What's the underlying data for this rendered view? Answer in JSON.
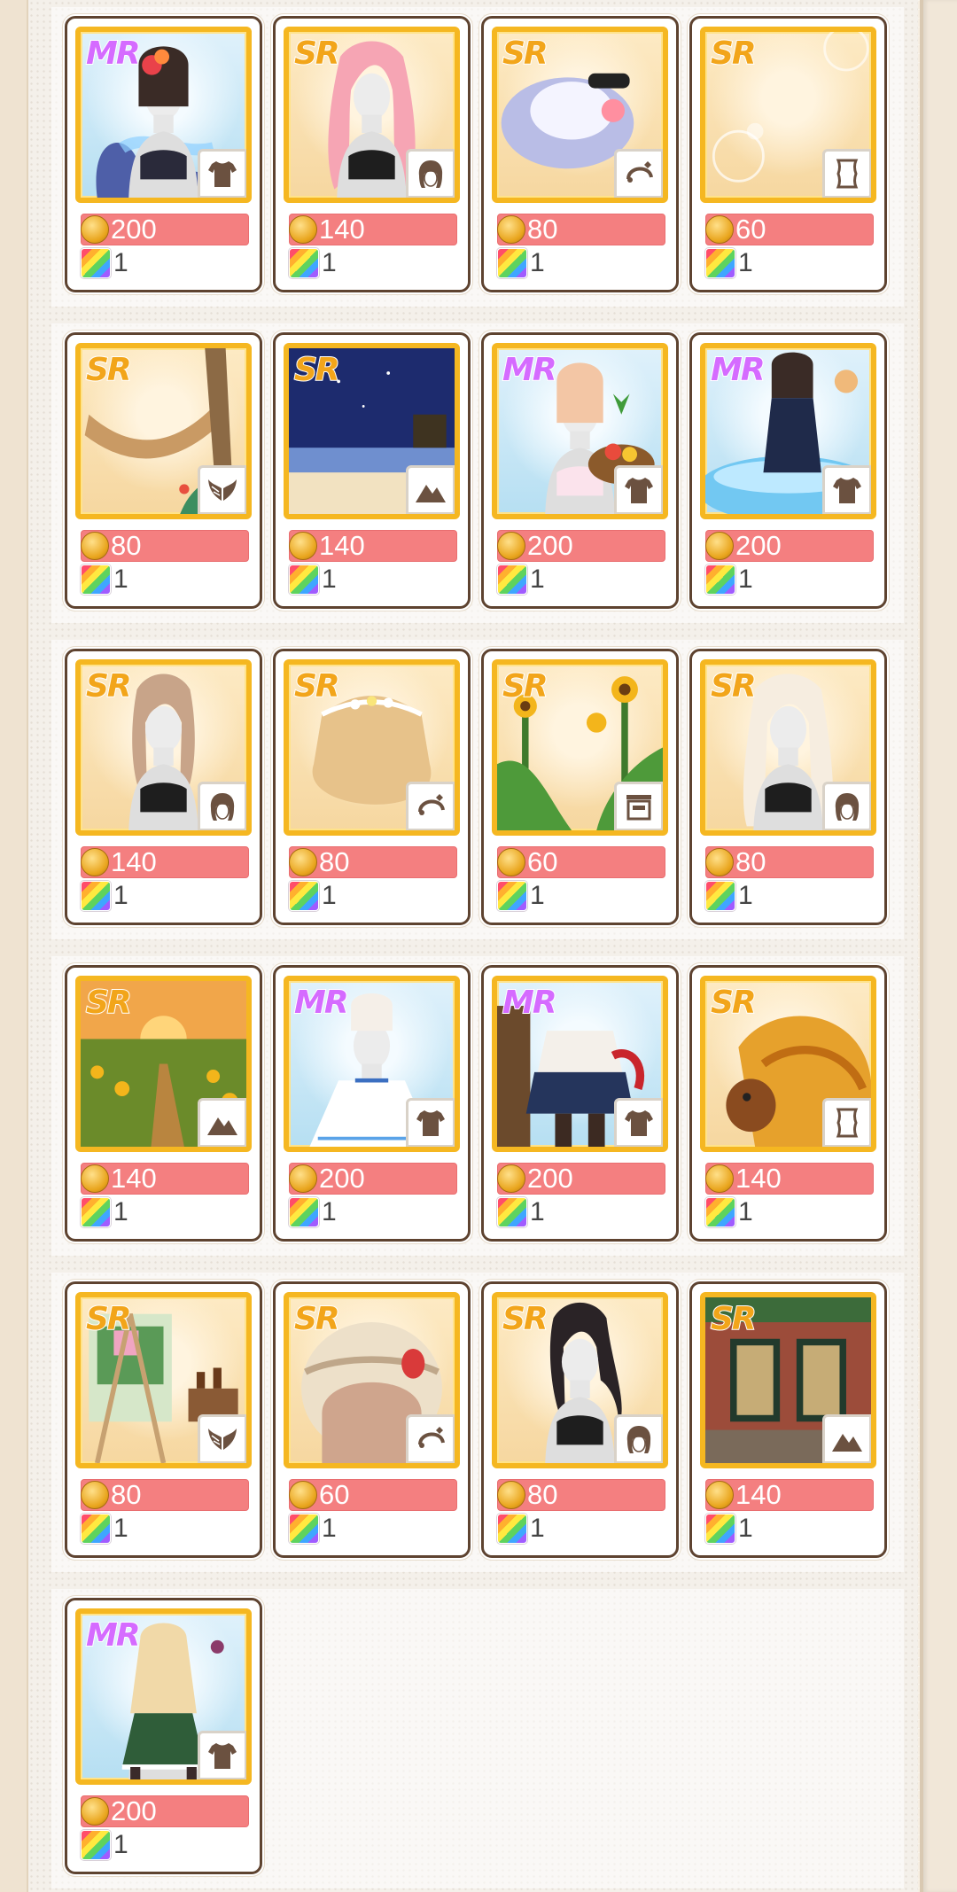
{
  "items": [
    {
      "rarity": "MR",
      "category": "clothes-icon",
      "price": "200",
      "qty": "1",
      "art": "swimsuit-mr"
    },
    {
      "rarity": "SR",
      "category": "hair-icon",
      "price": "140",
      "qty": "1",
      "art": "hair-pink"
    },
    {
      "rarity": "SR",
      "category": "accessory-icon",
      "price": "80",
      "qty": "1",
      "art": "sunhat"
    },
    {
      "rarity": "SR",
      "category": "frame-icon",
      "price": "60",
      "qty": "1",
      "art": "bubble-frame"
    },
    {
      "rarity": "SR",
      "category": "wings-icon",
      "price": "80",
      "qty": "1",
      "art": "hammock"
    },
    {
      "rarity": "SR",
      "category": "background-icon",
      "price": "140",
      "qty": "1",
      "art": "night-beach"
    },
    {
      "rarity": "MR",
      "category": "clothes-icon",
      "price": "200",
      "qty": "1",
      "art": "bikini-fruit"
    },
    {
      "rarity": "MR",
      "category": "clothes-icon",
      "price": "200",
      "qty": "1",
      "art": "pool-girl"
    },
    {
      "rarity": "SR",
      "category": "hair-icon",
      "price": "140",
      "qty": "1",
      "art": "hair-beige"
    },
    {
      "rarity": "SR",
      "category": "accessory-icon",
      "price": "80",
      "qty": "1",
      "art": "straw-hat"
    },
    {
      "rarity": "SR",
      "category": "furniture-icon",
      "price": "60",
      "qty": "1",
      "art": "sunflowers"
    },
    {
      "rarity": "SR",
      "category": "hair-icon",
      "price": "80",
      "qty": "1",
      "art": "hair-blonde"
    },
    {
      "rarity": "SR",
      "category": "background-icon",
      "price": "140",
      "qty": "1",
      "art": "sunflower-field"
    },
    {
      "rarity": "MR",
      "category": "clothes-icon",
      "price": "200",
      "qty": "1",
      "art": "white-dress"
    },
    {
      "rarity": "MR",
      "category": "clothes-icon",
      "price": "200",
      "qty": "1",
      "art": "sailor-outfit"
    },
    {
      "rarity": "SR",
      "category": "frame-icon",
      "price": "140",
      "qty": "1",
      "art": "autumn-leaves"
    },
    {
      "rarity": "SR",
      "category": "wings-icon",
      "price": "80",
      "qty": "1",
      "art": "easel"
    },
    {
      "rarity": "SR",
      "category": "accessory-icon",
      "price": "60",
      "qty": "1",
      "art": "knit-hat"
    },
    {
      "rarity": "SR",
      "category": "hair-icon",
      "price": "80",
      "qty": "1",
      "art": "hair-black"
    },
    {
      "rarity": "SR",
      "category": "background-icon",
      "price": "140",
      "qty": "1",
      "art": "cafe-front"
    },
    {
      "rarity": "MR",
      "category": "clothes-icon",
      "price": "200",
      "qty": "1",
      "art": "green-dress"
    }
  ],
  "colors": {
    "price_bar": "#f47f80",
    "frame_gold": "#f5b721",
    "card_border": "#5e4330"
  }
}
